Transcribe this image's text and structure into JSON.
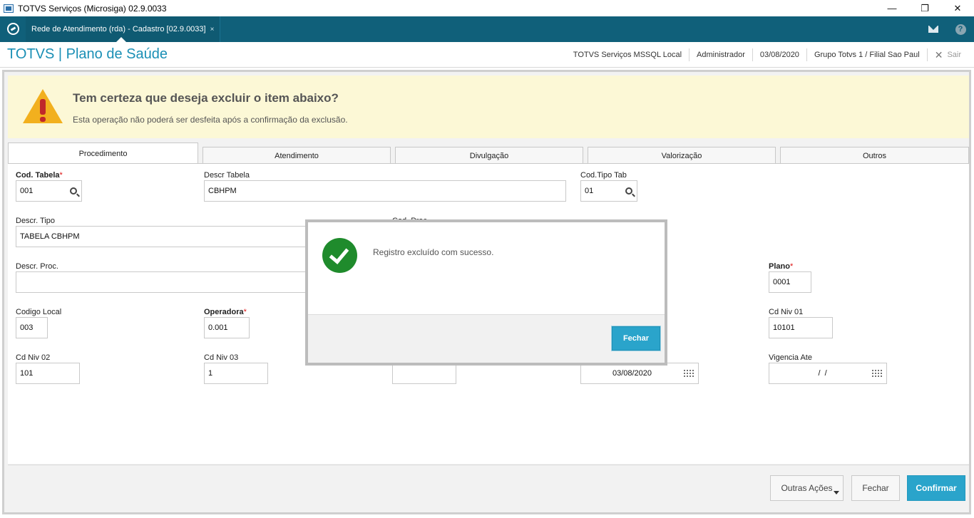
{
  "window": {
    "title": "TOTVS Serviços (Microsiga) 02.9.0033",
    "minimize_glyph": "—",
    "restore_glyph": "❐",
    "close_glyph": "✕"
  },
  "app_tabs": {
    "active_tab_label": "Rede de Atendimento (rda) - Cadastro [02.9.0033]",
    "close_glyph": "×"
  },
  "header": {
    "brand": "TOTVS | Plano de Saúde",
    "environment": "TOTVS Serviços MSSQL Local",
    "user": "Administrador",
    "date": "03/08/2020",
    "branch": "Grupo Totvs 1 / Filial Sao Paul",
    "exit_label": "Sair"
  },
  "warning": {
    "title": "Tem certeza que deseja excluir o item abaixo?",
    "subtitle": "Esta operação não poderá ser desfeita após a confirmação da exclusão."
  },
  "form_tabs": [
    "Procedimento",
    "Atendimento",
    "Divulgação",
    "Valorização",
    "Outros"
  ],
  "fields": {
    "cod_tabela": {
      "label": "Cod. Tabela",
      "value": "001"
    },
    "descr_tabela": {
      "label": "Descr Tabela",
      "value": "CBHPM"
    },
    "cod_tipo_tab": {
      "label": "Cod.Tipo Tab",
      "value": "01"
    },
    "descr_tipo": {
      "label": "Descr. Tipo",
      "value": "TABELA CBHPM"
    },
    "cod_proc": {
      "label": "Cod. Proc"
    },
    "descr_proc": {
      "label": "Descr. Proc.",
      "value": ""
    },
    "plano": {
      "label": "Plano",
      "value": "0001"
    },
    "codigo_local": {
      "label": "Codigo Local",
      "value": "003"
    },
    "operadora": {
      "label": "Operadora",
      "value": "0.001"
    },
    "cd_niv_01": {
      "label": "Cd Niv 01",
      "value": "10101"
    },
    "cd_niv_02": {
      "label": "Cd Niv 02",
      "value": "101"
    },
    "cd_niv_03": {
      "label": "Cd Niv 03",
      "value": "1"
    },
    "unlabeled_field": {
      "value": ""
    },
    "vigencia_de": {
      "value": "03/08/2020"
    },
    "vigencia_ate": {
      "label": "Vigencia Ate",
      "value": "  /  /"
    }
  },
  "required_marker": "*",
  "buttons": {
    "outras_acoes": "Outras Ações",
    "fechar": "Fechar",
    "confirmar": "Confirmar"
  },
  "modal": {
    "message": "Registro excluído com sucesso.",
    "close_label": "Fechar"
  },
  "colors": {
    "tabsbar": "#10607a",
    "brand": "#1a8fb5",
    "primary_button": "#2aa4cb",
    "warning_bg": "#fcf8d6",
    "success": "#1f8b2c",
    "required": "#dd1111"
  }
}
